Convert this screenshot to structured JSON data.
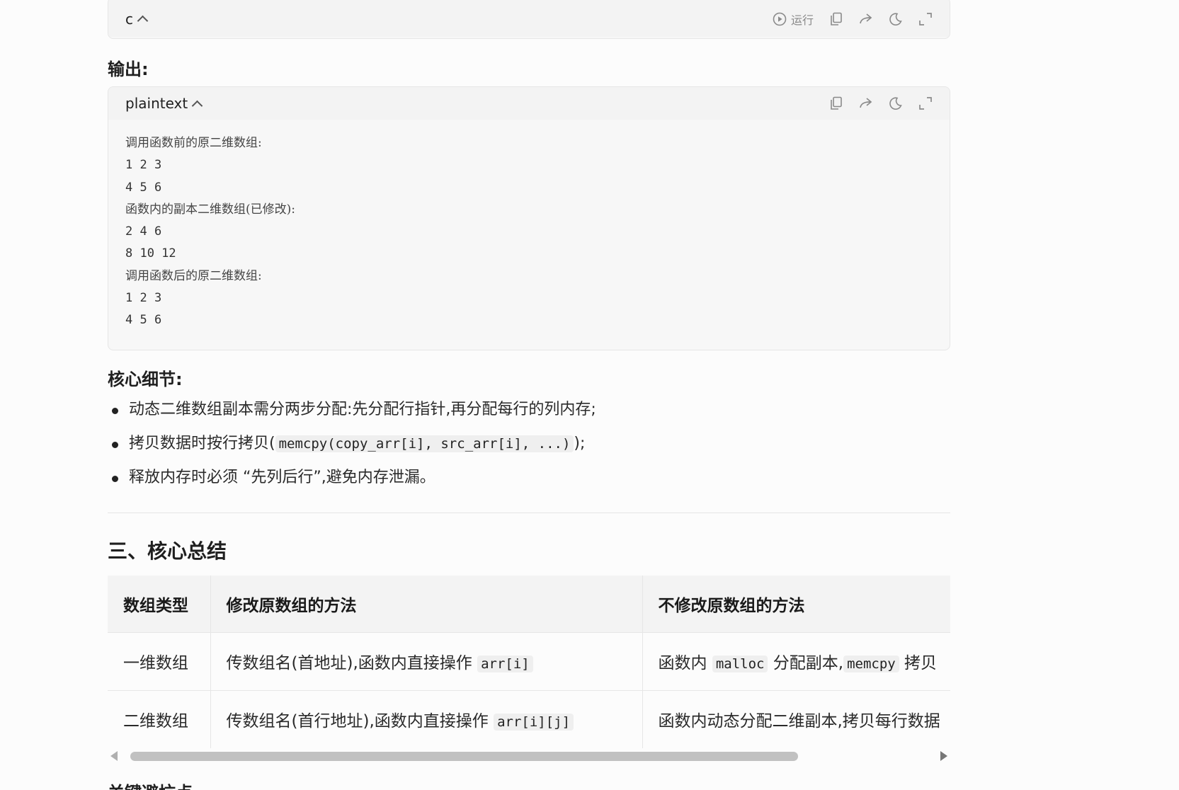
{
  "code_block_1": {
    "language": "c",
    "run_label": "运行"
  },
  "output_heading": "输出:",
  "code_block_2": {
    "language": "plaintext",
    "lines": [
      {
        "text": "调用函数前的原二维数组:",
        "cn": true
      },
      {
        "text": "1 2 3",
        "cn": false
      },
      {
        "text": "4 5 6",
        "cn": false
      },
      {
        "text": "函数内的副本二维数组(已修改):",
        "cn": true
      },
      {
        "text": "2 4 6",
        "cn": false
      },
      {
        "text": "8 10 12",
        "cn": false
      },
      {
        "text": "调用函数后的原二维数组:",
        "cn": true
      },
      {
        "text": "1 2 3",
        "cn": false
      },
      {
        "text": "4 5 6",
        "cn": false
      }
    ]
  },
  "core_details": {
    "heading": "核心细节:",
    "items": [
      {
        "before": "动态二维数组副本需分两步分配:先分配行指针,再分配每行的列内存;",
        "code": "",
        "after": ""
      },
      {
        "before": "拷贝数据时按行拷贝(",
        "code": "memcpy(copy_arr[i], src_arr[i], ...)",
        "after": ");"
      },
      {
        "before": "释放内存时必须 “先列后行”,避免内存泄漏。",
        "code": "",
        "after": ""
      }
    ]
  },
  "summary": {
    "heading": "三、核心总结",
    "columns": [
      "数组类型",
      "修改原数组的方法",
      "不修改原数组的方法"
    ],
    "rows": [
      {
        "type": "一维数组",
        "modify_text": "传数组名(首地址),函数内直接操作 ",
        "modify_code": "arr[i]",
        "nomod_a": "函数内 ",
        "nomod_code1": "malloc",
        "nomod_b": " 分配副本,",
        "nomod_code2": "memcpy",
        "nomod_c": " 拷贝"
      },
      {
        "type": "二维数组",
        "modify_text": "传数组名(首行地址),函数内直接操作 ",
        "modify_code": "arr[i][j]",
        "nomod_a": "函数内动态分配二维副本,拷贝每行数据"
      }
    ]
  },
  "next_heading": "关键避坑点"
}
